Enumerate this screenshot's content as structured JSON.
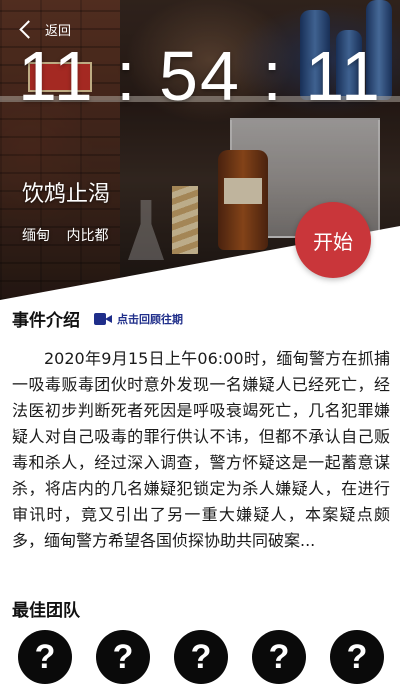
{
  "nav": {
    "back_label": "返回"
  },
  "hero": {
    "clock": "11 : 54 : 11",
    "title": "饮鸩止渴",
    "location": [
      "缅甸",
      "内比都"
    ],
    "start_label": "开始"
  },
  "event": {
    "section_title": "事件介绍",
    "replay_label": "点击回顾往期",
    "description": "2020年9月15日上午06:00时，缅甸警方在抓捕一吸毒贩毒团伙时意外发现一名嫌疑人已经死亡，经法医初步判断死者死因是呼吸衰竭死亡，几名犯罪嫌疑人对自己吸毒的罪行供认不讳，但都不承认自己贩毒和杀人，经过深入调查，警方怀疑这是一起蓄意谋杀，将店内的几名嫌疑犯锁定为杀人嫌疑人，在进行审讯时，竟又引出了另一重大嫌疑人，本案疑点颇多，缅甸警方希望各国侦探协助共同破案..."
  },
  "team": {
    "section_title": "最佳团队",
    "members": [
      "?",
      "?",
      "?",
      "?",
      "?"
    ]
  },
  "colors": {
    "accent_red": "#c9363a",
    "link_blue": "#1f2e8a"
  }
}
